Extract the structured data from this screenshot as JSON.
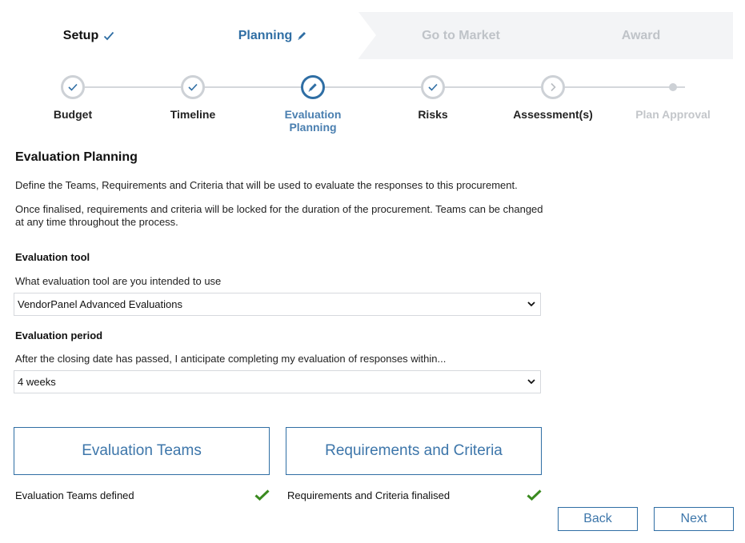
{
  "phases": [
    {
      "label": "Setup",
      "state": "done"
    },
    {
      "label": "Planning",
      "state": "active"
    },
    {
      "label": "Go to Market",
      "state": "upcoming"
    },
    {
      "label": "Award",
      "state": "upcoming"
    }
  ],
  "steps": [
    {
      "label": "Budget",
      "state": "done",
      "icon": "check-icon"
    },
    {
      "label": "Timeline",
      "state": "done",
      "icon": "check-icon"
    },
    {
      "label": "Evaluation Planning",
      "state": "active",
      "icon": "pencil-icon"
    },
    {
      "label": "Risks",
      "state": "done",
      "icon": "check-icon"
    },
    {
      "label": "Assessment(s)",
      "state": "next",
      "icon": "chevron-right-icon"
    },
    {
      "label": "Plan Approval",
      "state": "disabled",
      "icon": "dot"
    }
  ],
  "main": {
    "title": "Evaluation Planning",
    "description1": "Define the Teams, Requirements and Criteria that will be used to evaluate the responses to this procurement.",
    "description2": "Once finalised, requirements and criteria will be locked for the duration of the procurement. Teams can be changed at any time throughout the process.",
    "tool": {
      "heading": "Evaluation tool",
      "question": "What evaluation tool are you intended to use",
      "selected": "VendorPanel Advanced Evaluations"
    },
    "period": {
      "heading": "Evaluation period",
      "question": "After the closing date has passed, I anticipate completing my evaluation of responses within...",
      "selected": "4 weeks"
    }
  },
  "actions": {
    "teams_label": "Evaluation Teams",
    "teams_status": "Evaluation Teams defined",
    "requirements_label": "Requirements and Criteria",
    "requirements_status": "Requirements and Criteria finalised",
    "back_label": "Back",
    "next_label": "Next"
  },
  "colors": {
    "accent": "#2f6ea4",
    "success": "#3a8a1f",
    "muted": "#cdd1d6"
  }
}
